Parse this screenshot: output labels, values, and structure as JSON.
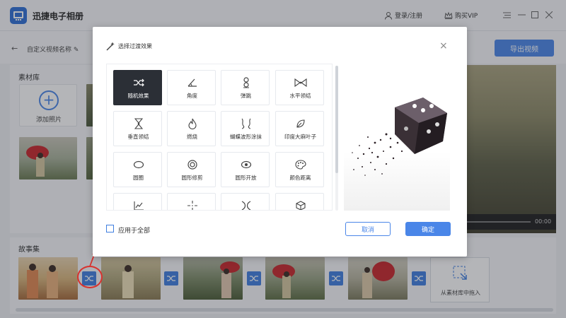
{
  "app": {
    "name": "迅捷电子相册",
    "login": "登录/注册",
    "vip": "购买VIP"
  },
  "project": {
    "name": "自定义视频名称",
    "export_label": "导出视频"
  },
  "library": {
    "title": "素材库",
    "add_photo_label": "添加照片"
  },
  "preview": {
    "time": "00:00"
  },
  "storyboard": {
    "title": "故事集",
    "drag_hint": "从素材库中拖入"
  },
  "dialog": {
    "title": "选择过渡效果",
    "effects": [
      {
        "label": "随机效果",
        "icon": "shuffle-icon",
        "selected": true
      },
      {
        "label": "角度",
        "icon": "angle-icon"
      },
      {
        "label": "弹跳",
        "icon": "bounce-icon"
      },
      {
        "label": "水平领结",
        "icon": "bowtie-horizontal-icon"
      },
      {
        "label": "垂直领结",
        "icon": "bowtie-vertical-icon"
      },
      {
        "label": "燃烧",
        "icon": "flame-icon"
      },
      {
        "label": "蝴蝶波形涂抹",
        "icon": "butterfly-wave-icon"
      },
      {
        "label": "印度大麻叶子",
        "icon": "leaf-icon"
      },
      {
        "label": "圆圈",
        "icon": "ellipse-icon"
      },
      {
        "label": "圆形修剪",
        "icon": "circle-crop-icon"
      },
      {
        "label": "圆形开放",
        "icon": "circle-open-icon"
      },
      {
        "label": "颜色距离",
        "icon": "palette-icon"
      },
      {
        "label": "",
        "icon": "chart-icon"
      },
      {
        "label": "",
        "icon": "crosshair-icon"
      },
      {
        "label": "",
        "icon": "cross-wave-icon"
      },
      {
        "label": "",
        "icon": "cube-icon"
      }
    ],
    "apply_all_label": "应用于全部",
    "cancel_label": "取消",
    "ok_label": "确定"
  },
  "colors": {
    "accent": "#4a86e8",
    "selected_tile": "#2b2f36",
    "highlight": "#d8322e"
  }
}
